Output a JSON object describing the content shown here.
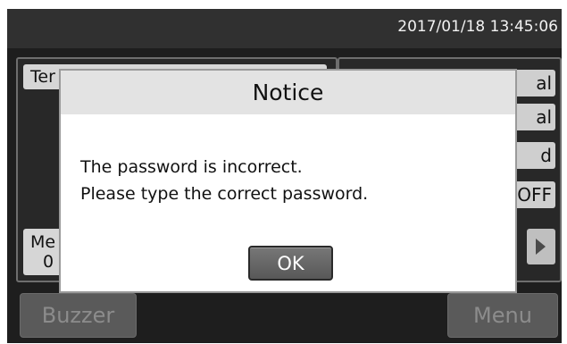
{
  "status_bar": {
    "datetime": "2017/01/18  13:45:06"
  },
  "background": {
    "left_panel": {
      "tab_label": "Ter",
      "mem_label_line1": "Me",
      "mem_label_line2": "0"
    },
    "right_panel": {
      "buttons": [
        "al",
        "al",
        "d",
        "OFF"
      ],
      "next_arrow": "triangle-right-icon"
    },
    "bottom": {
      "buzzer_label": "Buzzer",
      "menu_label": "Menu"
    }
  },
  "dialog": {
    "title": "Notice",
    "message_line1": "The password is incorrect.",
    "message_line2": "Please type the correct password.",
    "ok_label": "OK"
  },
  "colors": {
    "screen_bg": "#1e1e1e",
    "status_bar_bg": "#303030",
    "dialog_header_bg": "#e3e3e3",
    "ok_button_bg": "#666666"
  }
}
